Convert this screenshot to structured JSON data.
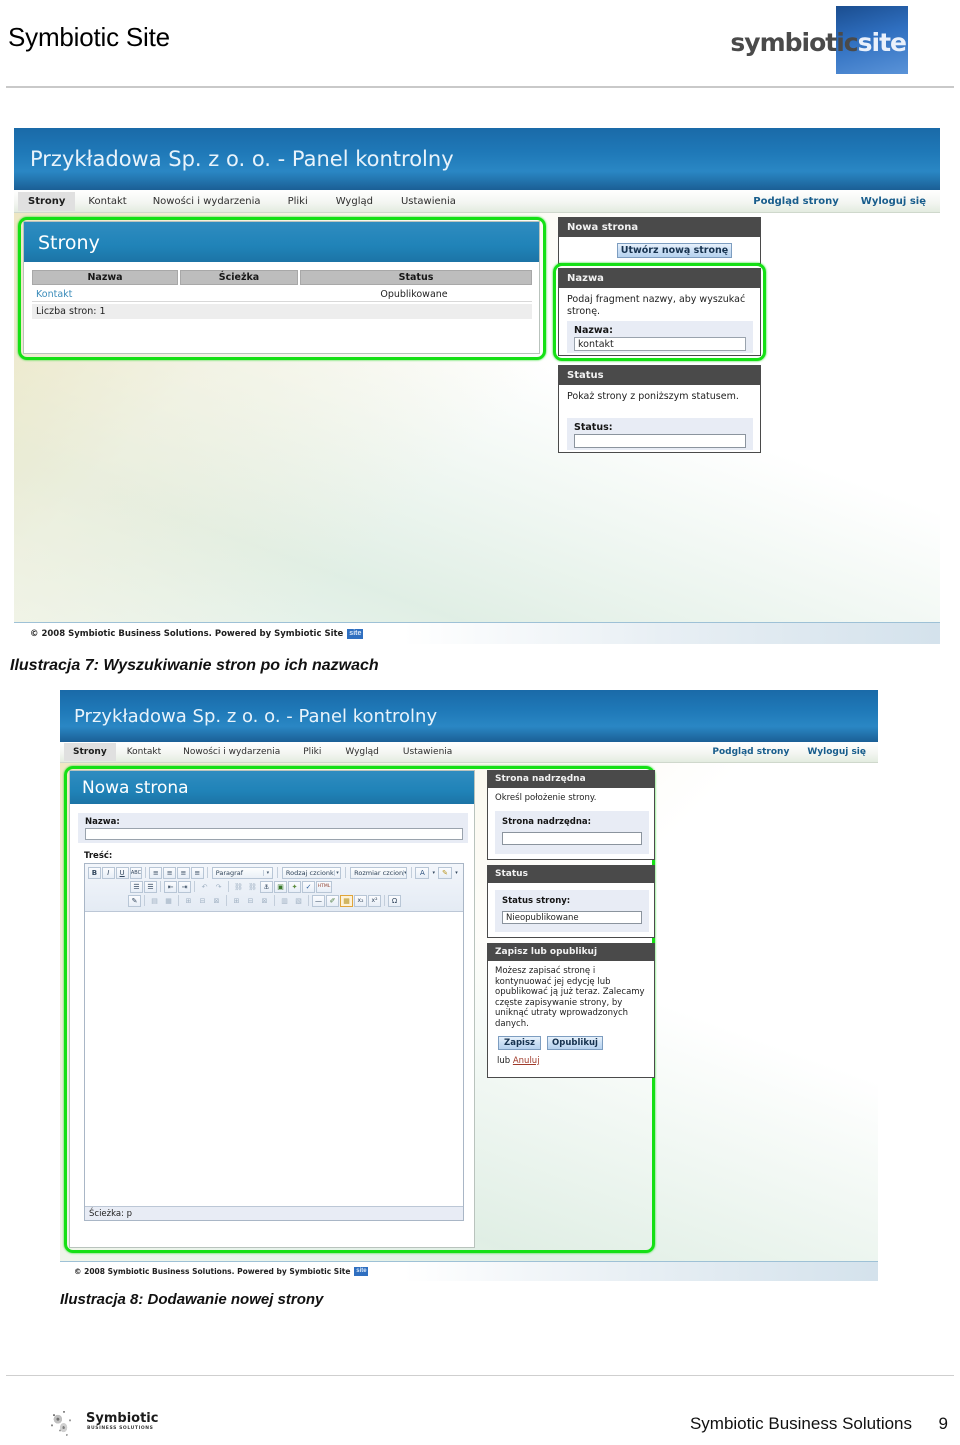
{
  "header": {
    "title": "Symbiotic Site",
    "brand_prefix": "symbiotic",
    "brand_suffix": "site"
  },
  "figure1": {
    "control_panel_title": "Przykładowa Sp. z o. o. - Panel kontrolny",
    "nav_left": [
      {
        "label": "Strony",
        "active": true
      },
      {
        "label": "Kontakt",
        "active": false
      },
      {
        "label": "Nowości i wydarzenia",
        "active": false
      },
      {
        "label": "Pliki",
        "active": false
      },
      {
        "label": "Wygląd",
        "active": false
      },
      {
        "label": "Ustawienia",
        "active": false
      }
    ],
    "nav_right": [
      {
        "label": "Podgląd strony"
      },
      {
        "label": "Wyloguj się"
      }
    ],
    "panel": {
      "title": "Strony",
      "columns": [
        "Nazwa",
        "Ścieżka",
        "Status"
      ],
      "rows": [
        {
          "nazwa": "Kontakt",
          "sciezka": "",
          "status": "Opublikowane"
        }
      ],
      "footer": "Liczba stron: 1"
    },
    "side_new_page": {
      "title": "Nowa strona",
      "button": "Utwórz nową stronę"
    },
    "side_name": {
      "title": "Nazwa",
      "description": "Podaj fragment nazwy, aby wyszukać stronę.",
      "field_label": "Nazwa:",
      "field_value": "kontakt"
    },
    "side_status": {
      "title": "Status",
      "description": "Pokaż strony z poniższym statusem.",
      "field_label": "Status:",
      "field_value": ""
    },
    "footer_text": "© 2008 Symbiotic Business Solutions. Powered by Symbiotic Site",
    "footer_badge": "site",
    "caption": "Ilustracja 7: Wyszukiwanie stron po ich nazwach"
  },
  "figure2": {
    "control_panel_title": "Przykładowa Sp. z o. o. - Panel kontrolny",
    "nav_left": [
      {
        "label": "Strony",
        "active": true
      },
      {
        "label": "Kontakt",
        "active": false
      },
      {
        "label": "Nowości i wydarzenia",
        "active": false
      },
      {
        "label": "Pliki",
        "active": false
      },
      {
        "label": "Wygląd",
        "active": false
      },
      {
        "label": "Ustawienia",
        "active": false
      }
    ],
    "nav_right": [
      {
        "label": "Podgląd strony"
      },
      {
        "label": "Wyloguj się"
      }
    ],
    "panel": {
      "title": "Nowa strona",
      "name_label": "Nazwa:",
      "name_value": "",
      "content_label": "Treść:",
      "editor_status": "Ścieżka: p"
    },
    "editor_toolbar": {
      "row1": [
        {
          "icon": "bold-icon",
          "glyph": "B",
          "state": "box"
        },
        {
          "icon": "italic-icon",
          "glyph": "I",
          "state": "box"
        },
        {
          "icon": "underline-icon",
          "glyph": "U",
          "state": "box"
        },
        {
          "icon": "strikethrough-icon",
          "glyph": "ABC",
          "state": "box"
        },
        {
          "icon": "align-left-icon",
          "glyph": "≡",
          "state": "box"
        },
        {
          "icon": "align-center-icon",
          "glyph": "≡",
          "state": "box"
        },
        {
          "icon": "align-right-icon",
          "glyph": "≡",
          "state": "box"
        },
        {
          "icon": "align-justify-icon",
          "glyph": "≡",
          "state": "box"
        }
      ],
      "combo_paragraph": "Paragraf",
      "combo_fontfamily": "Rodzaj czcionk",
      "combo_fontsize": "Rozmiar czcion",
      "row1_end": [
        {
          "icon": "text-color-icon",
          "glyph": "A",
          "state": "box"
        },
        {
          "icon": "highlight-color-icon",
          "glyph": "✎",
          "state": "box"
        }
      ],
      "row2": [
        {
          "icon": "bullet-list-icon",
          "glyph": "☰",
          "state": "box"
        },
        {
          "icon": "numbered-list-icon",
          "glyph": "☰",
          "state": "box"
        },
        {
          "icon": "outdent-icon",
          "glyph": "⇤",
          "state": "box"
        },
        {
          "icon": "indent-icon",
          "glyph": "⇥",
          "state": "box"
        },
        {
          "icon": "undo-icon",
          "glyph": "↶",
          "state": "dim"
        },
        {
          "icon": "redo-icon",
          "glyph": "↷",
          "state": "dim"
        },
        {
          "icon": "link-icon",
          "glyph": "🔗",
          "state": "dim"
        },
        {
          "icon": "unlink-icon",
          "glyph": "⛓",
          "state": "dim"
        },
        {
          "icon": "anchor-icon",
          "glyph": "⚓",
          "state": "box"
        },
        {
          "icon": "image-icon",
          "glyph": "▣",
          "state": "box"
        },
        {
          "icon": "cleanup-icon",
          "glyph": "🧹",
          "state": "box"
        },
        {
          "icon": "spellcheck-icon",
          "glyph": "✓",
          "state": "box"
        },
        {
          "icon": "html-source-icon",
          "glyph": "HTML",
          "state": "box"
        }
      ],
      "row3": [
        {
          "icon": "edit-page-icon",
          "glyph": "✎",
          "state": "box"
        },
        {
          "icon": "table-insert-icon",
          "glyph": "▤",
          "state": "dim"
        },
        {
          "icon": "table-props-icon",
          "glyph": "▦",
          "state": "dim"
        },
        {
          "icon": "row-before-icon",
          "glyph": "⊞",
          "state": "dim"
        },
        {
          "icon": "row-after-icon",
          "glyph": "⊟",
          "state": "dim"
        },
        {
          "icon": "row-delete-icon",
          "glyph": "⊠",
          "state": "dim"
        },
        {
          "icon": "col-before-icon",
          "glyph": "⊞",
          "state": "dim"
        },
        {
          "icon": "col-after-icon",
          "glyph": "⊟",
          "state": "dim"
        },
        {
          "icon": "col-delete-icon",
          "glyph": "⊠",
          "state": "dim"
        },
        {
          "icon": "cell-split-icon",
          "glyph": "▥",
          "state": "dim"
        },
        {
          "icon": "cell-merge-icon",
          "glyph": "▧",
          "state": "dim"
        },
        {
          "icon": "horizontal-rule-icon",
          "glyph": "—",
          "state": "box"
        },
        {
          "icon": "remove-format-icon",
          "glyph": "✐",
          "state": "box"
        },
        {
          "icon": "insert-table-icon",
          "glyph": "▦",
          "state": "sel"
        },
        {
          "icon": "subscript-icon",
          "glyph": "x₂",
          "state": "box"
        },
        {
          "icon": "superscript-icon",
          "glyph": "x²",
          "state": "box"
        },
        {
          "icon": "special-char-icon",
          "glyph": "Ω",
          "state": "box"
        }
      ]
    },
    "side_parent": {
      "title": "Strona nadrzędna",
      "description": "Określ położenie strony.",
      "field_label": "Strona nadrzędna:",
      "field_value": ""
    },
    "side_status": {
      "title": "Status",
      "field_label": "Status strony:",
      "field_value": "Nieopublikowane"
    },
    "side_save": {
      "title": "Zapisz lub opublikuj",
      "description": "Możesz zapisać stronę i kontynuować jej edycję lub opublikować ją już teraz. Zalecamy częste zapisywanie strony, by uniknąć utraty wprowadzonych danych.",
      "save_button": "Zapisz",
      "publish_button": "Opublikuj",
      "cancel_prefix": "lub",
      "cancel_link": "Anuluj"
    },
    "footer_text": "© 2008 Symbiotic Business Solutions. Powered by Symbiotic Site",
    "footer_badge": "site",
    "caption": "Ilustracja 8: Dodawanie nowej strony"
  },
  "page_footer": {
    "logo_name": "Symbiotic",
    "logo_sub": "BUSINESS SOLUTIONS",
    "company": "Symbiotic Business Solutions",
    "page_number": "9"
  }
}
